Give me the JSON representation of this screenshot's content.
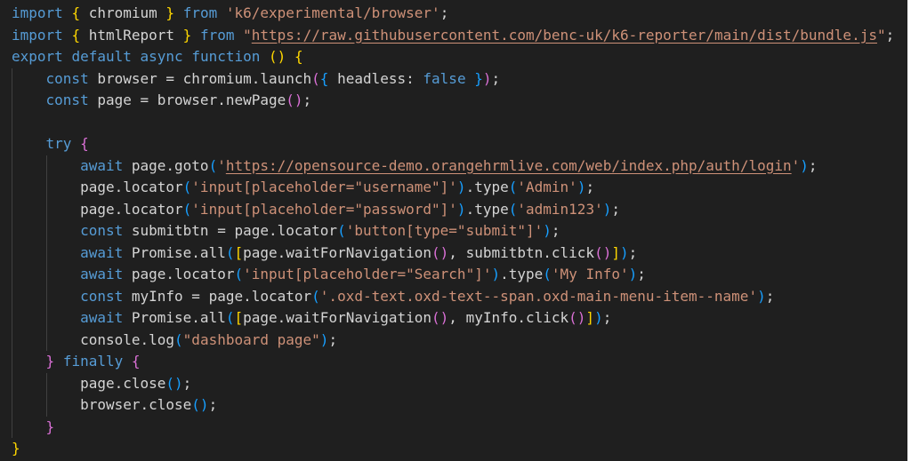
{
  "editor": {
    "language": "javascript",
    "lines": [
      [
        {
          "t": "import",
          "c": "kw"
        },
        {
          "t": " ",
          "c": "var"
        },
        {
          "t": "{",
          "c": "b1"
        },
        {
          "t": " chromium ",
          "c": "var"
        },
        {
          "t": "}",
          "c": "b1"
        },
        {
          "t": " ",
          "c": "var"
        },
        {
          "t": "from",
          "c": "kw"
        },
        {
          "t": " ",
          "c": "var"
        },
        {
          "t": "'k6/experimental/browser'",
          "c": "str"
        },
        {
          "t": ";",
          "c": "var"
        }
      ],
      [
        {
          "t": "import",
          "c": "kw"
        },
        {
          "t": " ",
          "c": "var"
        },
        {
          "t": "{",
          "c": "b1"
        },
        {
          "t": " htmlReport ",
          "c": "var"
        },
        {
          "t": "}",
          "c": "b1"
        },
        {
          "t": " ",
          "c": "var"
        },
        {
          "t": "from",
          "c": "kw"
        },
        {
          "t": " ",
          "c": "var"
        },
        {
          "t": "\"",
          "c": "str"
        },
        {
          "t": "https://raw.githubusercontent.com/benc-uk/k6-reporter/main/dist/bundle.js",
          "c": "url"
        },
        {
          "t": "\"",
          "c": "str"
        },
        {
          "t": ";",
          "c": "var"
        }
      ],
      [
        {
          "t": "export",
          "c": "kw"
        },
        {
          "t": " ",
          "c": "var"
        },
        {
          "t": "default",
          "c": "kw"
        },
        {
          "t": " ",
          "c": "var"
        },
        {
          "t": "async",
          "c": "kw"
        },
        {
          "t": " ",
          "c": "var"
        },
        {
          "t": "function",
          "c": "kw"
        },
        {
          "t": " ",
          "c": "var"
        },
        {
          "t": "()",
          "c": "b1"
        },
        {
          "t": " ",
          "c": "var"
        },
        {
          "t": "{",
          "c": "b1"
        }
      ],
      [
        {
          "t": "    ",
          "c": "var"
        },
        {
          "t": "const",
          "c": "kw"
        },
        {
          "t": " browser = chromium.launch",
          "c": "var"
        },
        {
          "t": "(",
          "c": "b2"
        },
        {
          "t": "{",
          "c": "b3"
        },
        {
          "t": " headless: ",
          "c": "var"
        },
        {
          "t": "false",
          "c": "kw"
        },
        {
          "t": " ",
          "c": "var"
        },
        {
          "t": "}",
          "c": "b3"
        },
        {
          "t": ")",
          "c": "b2"
        },
        {
          "t": ";",
          "c": "var"
        }
      ],
      [
        {
          "t": "    ",
          "c": "var"
        },
        {
          "t": "const",
          "c": "kw"
        },
        {
          "t": " page = browser.newPage",
          "c": "var"
        },
        {
          "t": "()",
          "c": "b2"
        },
        {
          "t": ";",
          "c": "var"
        }
      ],
      [],
      [
        {
          "t": "    ",
          "c": "var"
        },
        {
          "t": "try",
          "c": "kw"
        },
        {
          "t": " ",
          "c": "var"
        },
        {
          "t": "{",
          "c": "b2"
        }
      ],
      [
        {
          "t": "        ",
          "c": "var"
        },
        {
          "t": "await",
          "c": "kw"
        },
        {
          "t": " page.goto",
          "c": "var"
        },
        {
          "t": "(",
          "c": "b3"
        },
        {
          "t": "'",
          "c": "str"
        },
        {
          "t": "https://opensource-demo.orangehrmlive.com/web/index.php/auth/login",
          "c": "url"
        },
        {
          "t": "'",
          "c": "str"
        },
        {
          "t": ")",
          "c": "b3"
        },
        {
          "t": ";",
          "c": "var"
        }
      ],
      [
        {
          "t": "        page.locator",
          "c": "var"
        },
        {
          "t": "(",
          "c": "b3"
        },
        {
          "t": "'input[placeholder=\"username\"]'",
          "c": "str"
        },
        {
          "t": ")",
          "c": "b3"
        },
        {
          "t": ".type",
          "c": "var"
        },
        {
          "t": "(",
          "c": "b3"
        },
        {
          "t": "'Admin'",
          "c": "str"
        },
        {
          "t": ")",
          "c": "b3"
        },
        {
          "t": ";",
          "c": "var"
        }
      ],
      [
        {
          "t": "        page.locator",
          "c": "var"
        },
        {
          "t": "(",
          "c": "b3"
        },
        {
          "t": "'input[placeholder=\"password\"]'",
          "c": "str"
        },
        {
          "t": ")",
          "c": "b3"
        },
        {
          "t": ".type",
          "c": "var"
        },
        {
          "t": "(",
          "c": "b3"
        },
        {
          "t": "'admin123'",
          "c": "str"
        },
        {
          "t": ")",
          "c": "b3"
        },
        {
          "t": ";",
          "c": "var"
        }
      ],
      [
        {
          "t": "        ",
          "c": "var"
        },
        {
          "t": "const",
          "c": "kw"
        },
        {
          "t": " submitbtn = page.locator",
          "c": "var"
        },
        {
          "t": "(",
          "c": "b3"
        },
        {
          "t": "'button[type=\"submit\"]'",
          "c": "str"
        },
        {
          "t": ")",
          "c": "b3"
        },
        {
          "t": ";",
          "c": "var"
        }
      ],
      [
        {
          "t": "        ",
          "c": "var"
        },
        {
          "t": "await",
          "c": "kw"
        },
        {
          "t": " Promise.all",
          "c": "var"
        },
        {
          "t": "(",
          "c": "b3"
        },
        {
          "t": "[",
          "c": "b1"
        },
        {
          "t": "page.waitForNavigation",
          "c": "var"
        },
        {
          "t": "()",
          "c": "b2"
        },
        {
          "t": ", submitbtn.click",
          "c": "var"
        },
        {
          "t": "()",
          "c": "b2"
        },
        {
          "t": "]",
          "c": "b1"
        },
        {
          "t": ")",
          "c": "b3"
        },
        {
          "t": ";",
          "c": "var"
        }
      ],
      [
        {
          "t": "        ",
          "c": "var"
        },
        {
          "t": "await",
          "c": "kw"
        },
        {
          "t": " page.locator",
          "c": "var"
        },
        {
          "t": "(",
          "c": "b3"
        },
        {
          "t": "'input[placeholder=\"Search\"]'",
          "c": "str"
        },
        {
          "t": ")",
          "c": "b3"
        },
        {
          "t": ".type",
          "c": "var"
        },
        {
          "t": "(",
          "c": "b3"
        },
        {
          "t": "'My Info'",
          "c": "str"
        },
        {
          "t": ")",
          "c": "b3"
        },
        {
          "t": ";",
          "c": "var"
        }
      ],
      [
        {
          "t": "        ",
          "c": "var"
        },
        {
          "t": "const",
          "c": "kw"
        },
        {
          "t": " myInfo = page.locator",
          "c": "var"
        },
        {
          "t": "(",
          "c": "b3"
        },
        {
          "t": "'.oxd-text.oxd-text--span.oxd-main-menu-item--name'",
          "c": "str"
        },
        {
          "t": ")",
          "c": "b3"
        },
        {
          "t": ";",
          "c": "var"
        }
      ],
      [
        {
          "t": "        ",
          "c": "var"
        },
        {
          "t": "await",
          "c": "kw"
        },
        {
          "t": " Promise.all",
          "c": "var"
        },
        {
          "t": "(",
          "c": "b3"
        },
        {
          "t": "[",
          "c": "b1"
        },
        {
          "t": "page.waitForNavigation",
          "c": "var"
        },
        {
          "t": "()",
          "c": "b2"
        },
        {
          "t": ", myInfo.click",
          "c": "var"
        },
        {
          "t": "()",
          "c": "b2"
        },
        {
          "t": "]",
          "c": "b1"
        },
        {
          "t": ")",
          "c": "b3"
        },
        {
          "t": ";",
          "c": "var"
        }
      ],
      [
        {
          "t": "        console.log",
          "c": "var"
        },
        {
          "t": "(",
          "c": "b3"
        },
        {
          "t": "\"dashboard page\"",
          "c": "str"
        },
        {
          "t": ")",
          "c": "b3"
        },
        {
          "t": ";",
          "c": "var"
        }
      ],
      [
        {
          "t": "    ",
          "c": "var"
        },
        {
          "t": "}",
          "c": "b2"
        },
        {
          "t": " ",
          "c": "var"
        },
        {
          "t": "finally",
          "c": "kw"
        },
        {
          "t": " ",
          "c": "var"
        },
        {
          "t": "{",
          "c": "b2"
        }
      ],
      [
        {
          "t": "        page.close",
          "c": "var"
        },
        {
          "t": "()",
          "c": "b3"
        },
        {
          "t": ";",
          "c": "var"
        }
      ],
      [
        {
          "t": "        browser.close",
          "c": "var"
        },
        {
          "t": "()",
          "c": "b3"
        },
        {
          "t": ";",
          "c": "var"
        }
      ],
      [
        {
          "t": "    ",
          "c": "var"
        },
        {
          "t": "}",
          "c": "b2"
        }
      ],
      [
        {
          "t": "}",
          "c": "b1"
        }
      ]
    ]
  }
}
